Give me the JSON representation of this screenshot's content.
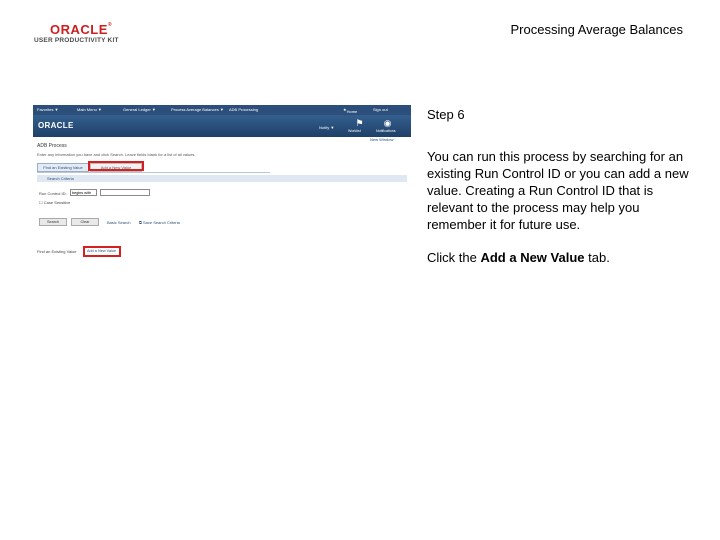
{
  "header": {
    "logo_brand": "ORACLE",
    "logo_subtitle": "USER PRODUCTIVITY KIT",
    "doc_title": "Processing Average Balances"
  },
  "screenshot": {
    "menu": [
      "Favorites ▼",
      "Main Menu ▼",
      "General Ledger ▼",
      "Process Average Balances ▼",
      "ADB Processing"
    ],
    "home": "Home",
    "signout": "Sign out",
    "brand": "ORACLE",
    "notify": "Notify ▼",
    "tools": [
      "Worklist",
      "Notifications"
    ],
    "new_window": "New Window",
    "heading": "ADB Process",
    "instructions": "Enter any information you have and click Search. Leave fields blank for a list of all values.",
    "tab_find": "Find an Existing Value",
    "tab_add": "Add a New Value",
    "search_criteria": "Search Criteria",
    "field_label": "Run Control ID:",
    "field_operator": "begins with",
    "case_sensitive": "Case Sensitive",
    "buttons": [
      "Search",
      "Clear"
    ],
    "links": [
      "Basic Search",
      "Save Search Criteria"
    ],
    "find_by": "Find an Existing Value",
    "find_by_link": "Add a New Value"
  },
  "content": {
    "step_label": "Step 6",
    "body": "You can run this process by searching for an existing Run Control ID or you can add a new value. Creating a Run Control ID that is relevant to the process may help you remember it for future use.",
    "click_prefix": "Click the ",
    "click_target": "Add a New Value",
    "click_suffix": " tab."
  }
}
